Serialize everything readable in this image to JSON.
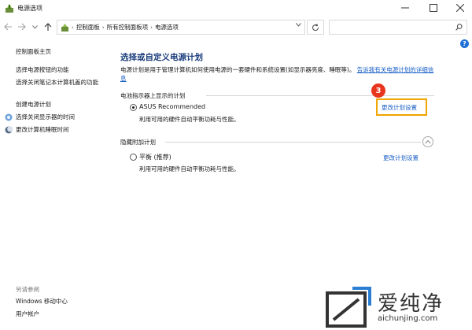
{
  "window": {
    "title": "电源选项"
  },
  "address": {
    "crumbs": [
      "控制面板",
      "所有控制面板项",
      "电源选项"
    ],
    "search_placeholder": ""
  },
  "left": {
    "home": "控制面板主页",
    "links": [
      "选择电源按钮的功能",
      "选择关闭笔记本计算机盖的功能",
      "创建电源计划",
      "选择关闭显示器的时间",
      "更改计算机睡眠时间"
    ],
    "see_also_heading": "另请参阅",
    "see_also": [
      "Windows 移动中心",
      "用户帐户"
    ]
  },
  "main": {
    "title": "选择或自定义电源计划",
    "intro_text": "电源计划是用于管理计算机如何使用电源的一套硬件和系统设置(如显示器亮度、睡眠等)。",
    "intro_link": "告诉我有关电源计划的详细信息",
    "battery_section": "电池指示器上显示的计划",
    "hidden_section": "隐藏附加计划",
    "plans": [
      {
        "name": "ASUS Recommended",
        "desc": "利用可用的硬件自动平衡功耗与性能。",
        "link": "更改计划设置",
        "selected": true
      },
      {
        "name": "平衡 (推荐)",
        "desc": "利用可用的硬件自动平衡功耗与性能。",
        "link": "更改计划设置",
        "selected": false
      }
    ],
    "step_number": "3"
  },
  "watermark": {
    "text": "爱纯净",
    "url": "aichunjing.com"
  },
  "colors": {
    "link": "#1a5fc7",
    "title": "#1a3d7c",
    "highlight": "#f0a500",
    "badge": "#e8361e"
  }
}
